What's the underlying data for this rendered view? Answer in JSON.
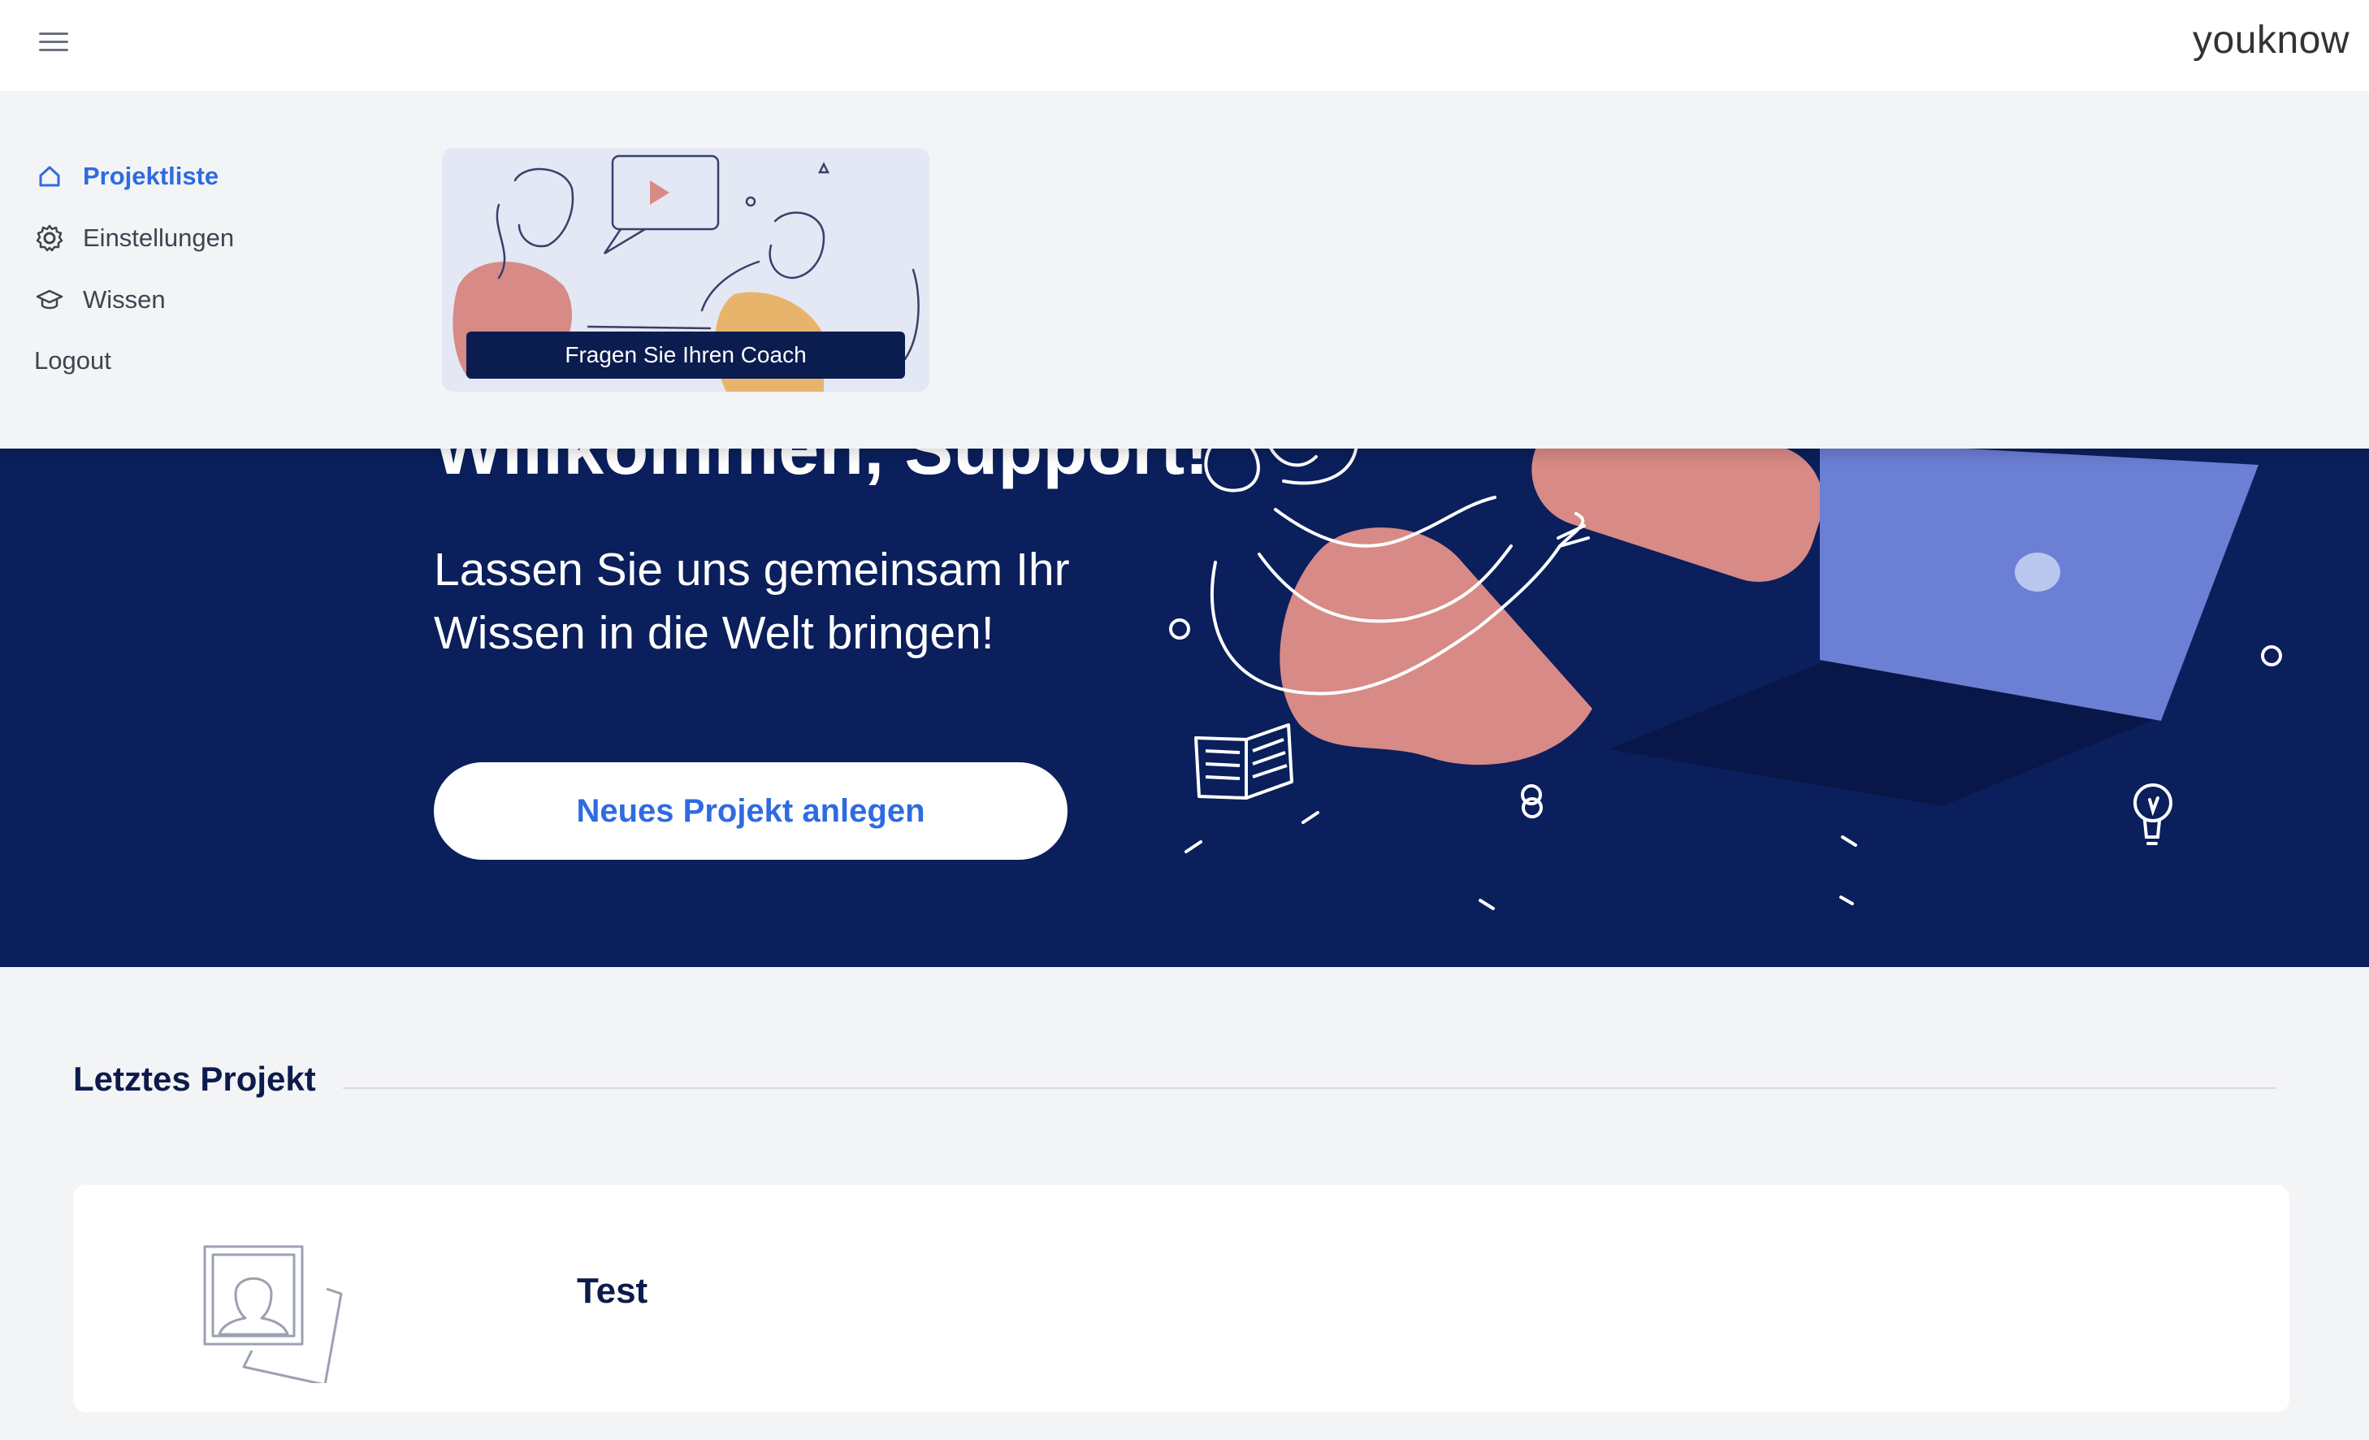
{
  "header": {
    "brand": "youknow",
    "menu_icon": "hamburger-menu-icon"
  },
  "sidebar": {
    "items": [
      {
        "label": "Projektliste",
        "icon": "home-icon",
        "active": true
      },
      {
        "label": "Einstellungen",
        "icon": "gear-icon",
        "active": false
      },
      {
        "label": "Wissen",
        "icon": "graduation-cap-icon",
        "active": false
      },
      {
        "label": "Logout",
        "icon": "",
        "active": false
      }
    ]
  },
  "coach": {
    "button_label": "Fragen Sie Ihren Coach"
  },
  "hero": {
    "title": "Willkommen, Support!",
    "subtitle": "Lassen Sie uns gemeinsam Ihr Wissen in die Welt bringen!",
    "cta_label": "Neues Projekt anlegen"
  },
  "last_project": {
    "section_title": "Letztes Projekt",
    "project_name": "Test",
    "thumbnail_icon": "person-placeholder-icon"
  },
  "colors": {
    "accent": "#2f6be0",
    "navy": "#0a1f5c",
    "coral": "#d88a86",
    "laptop": "#6b7fd4",
    "background": "#f3f4f6"
  }
}
